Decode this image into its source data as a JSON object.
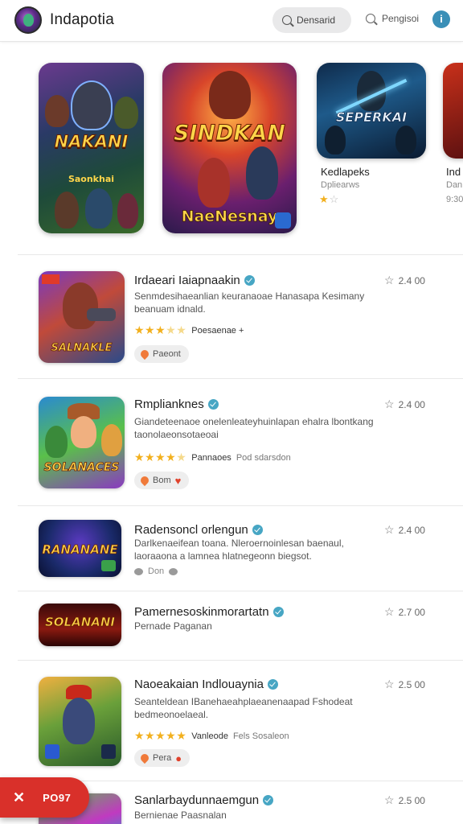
{
  "header": {
    "app_title": "Indapotia",
    "search_placeholder": "Densarid",
    "right_search_label": "Pengisoi",
    "info_glyph": "i"
  },
  "featured": [
    {
      "art_title": "NAKANI",
      "art_subtitle": "Saonkhai"
    },
    {
      "art_title": "SINDKAN",
      "art_subtitle": "NaeNesnay"
    },
    {
      "art_title": "SEPERKAI",
      "name": "Kedlapeks",
      "category": "Dpliearws",
      "stars": 1
    },
    {
      "name": "Ind",
      "category": "Dan",
      "meta": "9:30"
    }
  ],
  "list": [
    {
      "name": "Irdaeari Iaiapnaakin",
      "description": "Senmdesihaeanlian keuranaoae Hanasapa Kesimany beanuam idnald.",
      "rating_stars": 3,
      "rating_text": "Poesaenae +",
      "chip": "Paeont",
      "score": "2.4 00",
      "thumb_label": "SALNAKLE"
    },
    {
      "name": "Rmplianknes",
      "description": "Giandeteenaoe onelenleateyhuinlapan ehalra lbontkang taonolaeonsotaeoai",
      "rating_stars": 4,
      "rating_text": "Pannaoes",
      "rating_extra": "Pod sdarsdon",
      "chip": "Bom",
      "score": "2.4 00",
      "thumb_label": "SOLANACES"
    },
    {
      "name": "Radensoncl orlengun",
      "description": "Darlkenaeifean toana. Nleroernoinlesan baenaul, laoraaona a lamnea hlatnegeonn biegsot.",
      "like_label": "Don",
      "score": "2.4 00",
      "thumb_label": "RANANANE"
    },
    {
      "name": "Pamernesoskinmorartatn",
      "description": "Pernade Paganan",
      "score": "2.7 00",
      "thumb_label": "SOLANANI"
    },
    {
      "name": "Naoeakaian Indlouaynia",
      "description": "Seanteldean IBanehaeahplaeanenaapad Fshodeat bedmeonoelaeal.",
      "rating_stars": 5,
      "rating_text": "Vanleode",
      "rating_extra": "Fels Sosaleon",
      "chip": "Pera",
      "score": "2.5 00"
    },
    {
      "name": "Sanlarbaydunnaemgun",
      "description": "Bernienae Paasnalan",
      "score": "2.5 00"
    }
  ],
  "fab": {
    "label": "PO97"
  },
  "colors": {
    "accent": "#d9302a",
    "verified": "#47a6c4",
    "star": "#f2b01e"
  }
}
